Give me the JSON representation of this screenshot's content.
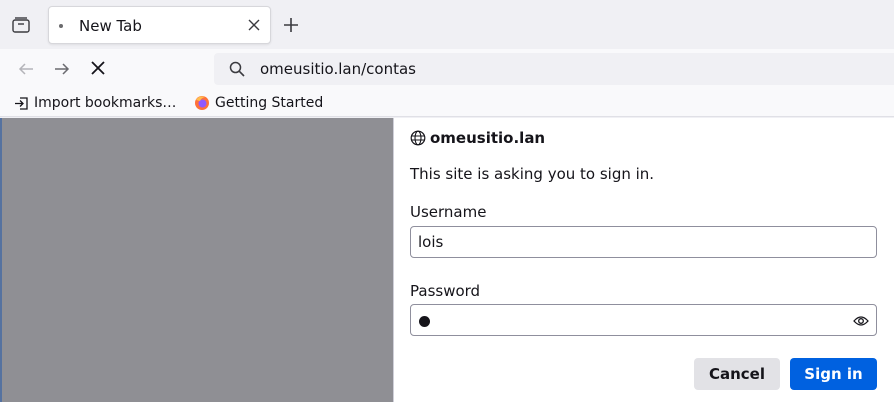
{
  "tab": {
    "title": "New Tab"
  },
  "urlbar": {
    "value": "omeusitio.lan/contas"
  },
  "bookmarks": [
    {
      "label": "Import bookmarks…",
      "icon": "import-icon"
    },
    {
      "label": "Getting Started",
      "icon": "firefox-icon"
    }
  ],
  "dialog": {
    "host": "omeusitio.lan",
    "message": "This site is asking you to sign in.",
    "username_label": "Username",
    "username_value": "lois",
    "password_label": "Password",
    "cancel_label": "Cancel",
    "signin_label": "Sign in"
  },
  "colors": {
    "accent": "#0061e0",
    "content_overlay": "#8f8f94"
  }
}
